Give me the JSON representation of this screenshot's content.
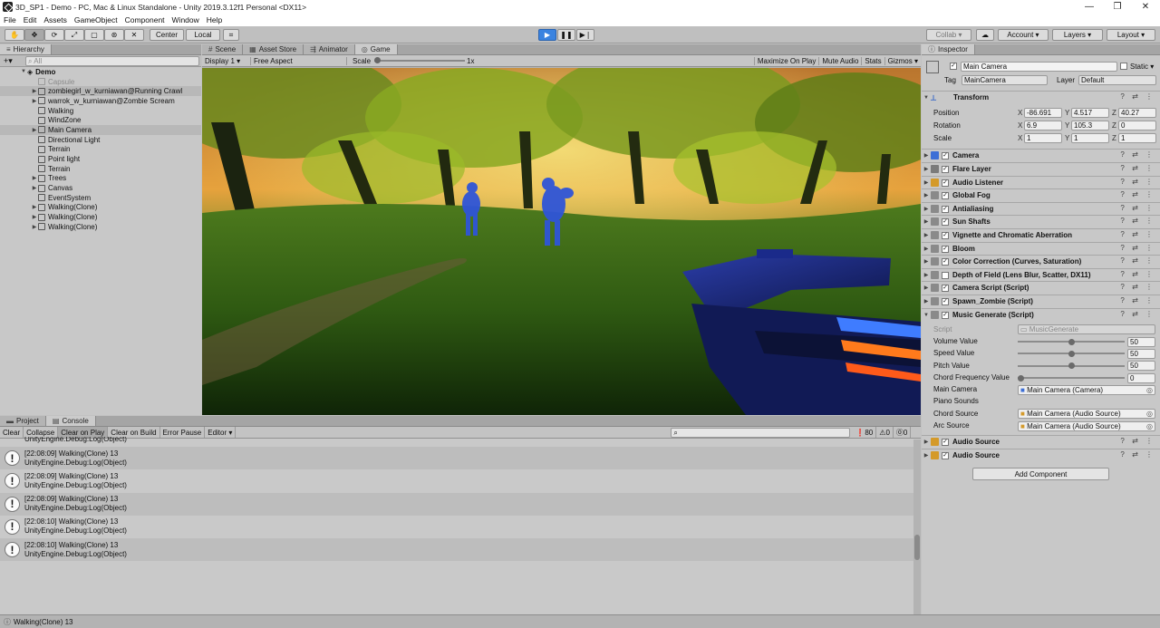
{
  "window": {
    "title": "3D_SP1 - Demo - PC, Mac & Linux Standalone - Unity 2019.3.12f1 Personal <DX11>",
    "controls": [
      "—",
      "❐",
      "✕"
    ]
  },
  "menu": [
    "File",
    "Edit",
    "Assets",
    "GameObject",
    "Component",
    "Window",
    "Help"
  ],
  "toolbar": {
    "pivot_label": "Center",
    "space_label": "Local",
    "collab_label": "Collab",
    "account_label": "Account",
    "layers_label": "Layers",
    "layout_label": "Layout"
  },
  "hierarchy": {
    "tab_label": "Hierarchy",
    "search_placeholder": "All",
    "scene_name": "Demo",
    "items": [
      {
        "label": "Capsule",
        "expandable": false,
        "dim": true,
        "selected": false
      },
      {
        "label": "zombiegirl_w_kurniawan@Running Crawl",
        "expandable": true,
        "dim": false,
        "selected": true
      },
      {
        "label": "warrok_w_kurniawan@Zombie Scream",
        "expandable": true,
        "dim": false,
        "selected": false
      },
      {
        "label": "Walking",
        "expandable": false,
        "dim": false,
        "selected": false
      },
      {
        "label": "WindZone",
        "expandable": false,
        "dim": false,
        "selected": false
      },
      {
        "label": "Main Camera",
        "expandable": true,
        "dim": false,
        "selected": true
      },
      {
        "label": "Directional Light",
        "expandable": false,
        "dim": false,
        "selected": false
      },
      {
        "label": "Terrain",
        "expandable": false,
        "dim": false,
        "selected": false
      },
      {
        "label": "Point light",
        "expandable": false,
        "dim": false,
        "selected": false
      },
      {
        "label": "Terrain",
        "expandable": false,
        "dim": false,
        "selected": false
      },
      {
        "label": "Trees",
        "expandable": true,
        "dim": false,
        "selected": false
      },
      {
        "label": "Canvas",
        "expandable": true,
        "dim": false,
        "selected": false
      },
      {
        "label": "EventSystem",
        "expandable": false,
        "dim": false,
        "selected": false
      },
      {
        "label": "Walking(Clone)",
        "expandable": true,
        "dim": false,
        "selected": false
      },
      {
        "label": "Walking(Clone)",
        "expandable": true,
        "dim": false,
        "selected": false
      },
      {
        "label": "Walking(Clone)",
        "expandable": true,
        "dim": false,
        "selected": false
      }
    ]
  },
  "view_tabs": [
    {
      "label": "Scene",
      "icon": "#",
      "active": false
    },
    {
      "label": "Asset Store",
      "icon": "▦",
      "active": false
    },
    {
      "label": "Animator",
      "icon": "⇶",
      "active": false
    },
    {
      "label": "Game",
      "icon": "◎",
      "active": true
    }
  ],
  "game_toolbar": {
    "display": "Display 1",
    "aspect": "Free Aspect",
    "scale_label": "Scale",
    "scale_value": "1x",
    "maximize": "Maximize On Play",
    "mute": "Mute Audio",
    "stats": "Stats",
    "gizmos": "Gizmos"
  },
  "console": {
    "tabs": [
      {
        "label": "Project",
        "active": false
      },
      {
        "label": "Console",
        "active": true
      }
    ],
    "buttons": [
      "Clear",
      "Collapse",
      "Clear on Play",
      "Clear on Build",
      "Error Pause",
      "Editor"
    ],
    "counts": {
      "info": "80",
      "warn": "0",
      "error": "0"
    },
    "partial_line": "UnityEngine.Debug:Log(Object)",
    "logs": [
      {
        "line1": "[22:08:09] Walking(Clone) 13",
        "line2": "UnityEngine.Debug:Log(Object)"
      },
      {
        "line1": "[22:08:09] Walking(Clone) 13",
        "line2": "UnityEngine.Debug:Log(Object)"
      },
      {
        "line1": "[22:08:09] Walking(Clone) 13",
        "line2": "UnityEngine.Debug:Log(Object)"
      },
      {
        "line1": "[22:08:10] Walking(Clone) 13",
        "line2": "UnityEngine.Debug:Log(Object)"
      },
      {
        "line1": "[22:08:10] Walking(Clone) 13",
        "line2": "UnityEngine.Debug:Log(Object)"
      }
    ]
  },
  "inspector": {
    "tab_label": "Inspector",
    "object_name": "Main Camera",
    "static_label": "Static",
    "tag_label": "Tag",
    "tag_value": "MainCamera",
    "layer_label": "Layer",
    "layer_value": "Default",
    "transform": {
      "label": "Transform",
      "position_label": "Position",
      "rotation_label": "Rotation",
      "scale_label": "Scale",
      "position": [
        "-86.691",
        "4.517",
        "40.27"
      ],
      "rotation": [
        "6.9",
        "105.3",
        "0"
      ],
      "scale": [
        "1",
        "1",
        "1"
      ]
    },
    "components": [
      {
        "label": "Camera",
        "color": "#3d6fd6"
      },
      {
        "label": "Flare Layer",
        "color": "#7b7b7b"
      },
      {
        "label": "Audio Listener",
        "color": "#d49a2a"
      },
      {
        "label": "Global Fog",
        "color": "#8a8a8a"
      },
      {
        "label": "Antialiasing",
        "color": "#8a8a8a"
      },
      {
        "label": "Sun Shafts",
        "color": "#8a8a8a"
      },
      {
        "label": "Vignette and Chromatic Aberration",
        "color": "#8a8a8a"
      },
      {
        "label": "Bloom",
        "color": "#8a8a8a"
      },
      {
        "label": "Color Correction (Curves, Saturation)",
        "color": "#8a8a8a"
      },
      {
        "label": "Depth of Field (Lens Blur, Scatter, DX11)",
        "color": "#8a8a8a"
      },
      {
        "label": "Camera Script (Script)",
        "color": "#8a8a8a"
      },
      {
        "label": "Spawn_Zombie (Script)",
        "color": "#8a8a8a"
      },
      {
        "label": "Music Generate (Script)",
        "color": "#8a8a8a"
      }
    ],
    "music": {
      "script_label": "Script",
      "script_value": "MusicGenerate",
      "sliders": [
        {
          "label": "Volume Value",
          "value": "50",
          "fraction": 0.5
        },
        {
          "label": "Speed Value",
          "value": "50",
          "fraction": 0.5
        },
        {
          "label": "Pitch Value",
          "value": "50",
          "fraction": 0.5
        },
        {
          "label": "Chord Frequency Value",
          "value": "0",
          "fraction": 0.0
        }
      ],
      "refs": [
        {
          "label": "Main Camera",
          "value": "Main Camera (Camera)"
        },
        {
          "label": "Piano Sounds",
          "value": ""
        },
        {
          "label": "Chord Source",
          "value": "Main Camera (Audio Source)"
        },
        {
          "label": "Arc Source",
          "value": "Main Camera (Audio Source)"
        }
      ]
    },
    "audio_sources": [
      "Audio Source",
      "Audio Source"
    ],
    "add_component": "Add Component"
  },
  "status": "Walking(Clone) 13"
}
